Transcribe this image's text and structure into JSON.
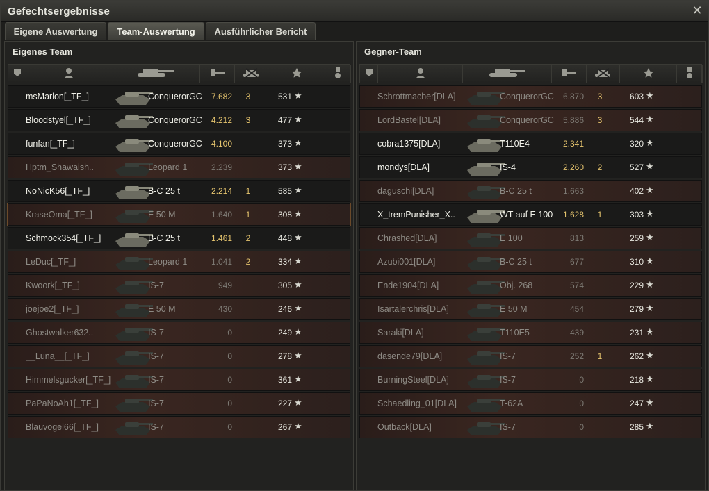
{
  "window": {
    "title": "Gefechtsergebnisse",
    "close_label": "✕"
  },
  "tabs": [
    {
      "label": "Eigene Auswertung"
    },
    {
      "label": "Team-Auswertung"
    },
    {
      "label": "Ausführlicher Bericht"
    }
  ],
  "own_team": {
    "title": "Eigenes Team",
    "rows": [
      {
        "name": "msMarlon[_TF_]",
        "tank": "ConquerorGC",
        "damage": "7.682",
        "kills": "3",
        "xp": "531",
        "alive": true
      },
      {
        "name": "Bloodstyel[_TF_]",
        "tank": "ConquerorGC",
        "damage": "4.212",
        "kills": "3",
        "xp": "477",
        "alive": true
      },
      {
        "name": "funfan[_TF_]",
        "tank": "ConquerorGC",
        "damage": "4.100",
        "kills": "",
        "xp": "373",
        "alive": true
      },
      {
        "name": "Hptm_Shawaish..",
        "tank": "Leopard 1",
        "damage": "2.239",
        "kills": "",
        "xp": "373",
        "alive": false
      },
      {
        "name": "NoNicK56[_TF_]",
        "tank": "B-C 25 t",
        "damage": "2.214",
        "kills": "1",
        "xp": "585",
        "alive": true
      },
      {
        "name": "KraseOma[_TF_]",
        "tank": "E 50 M",
        "damage": "1.640",
        "kills": "1",
        "xp": "308",
        "alive": false,
        "highlight": true
      },
      {
        "name": "Schmock354[_TF_]",
        "tank": "B-C 25 t",
        "damage": "1.461",
        "kills": "2",
        "xp": "448",
        "alive": true
      },
      {
        "name": "LeDuc[_TF_]",
        "tank": "Leopard 1",
        "damage": "1.041",
        "kills": "2",
        "xp": "334",
        "alive": false
      },
      {
        "name": "Kwoork[_TF_]",
        "tank": "IS-7",
        "damage": "949",
        "kills": "",
        "xp": "305",
        "alive": false
      },
      {
        "name": "joejoe2[_TF_]",
        "tank": "E 50 M",
        "damage": "430",
        "kills": "",
        "xp": "246",
        "alive": false
      },
      {
        "name": "Ghostwalker632..",
        "tank": "IS-7",
        "damage": "0",
        "kills": "",
        "xp": "249",
        "alive": false
      },
      {
        "name": "__Luna__[_TF_]",
        "tank": "IS-7",
        "damage": "0",
        "kills": "",
        "xp": "278",
        "alive": false
      },
      {
        "name": "Himmelsgucker[_TF_]",
        "tank": "IS-7",
        "damage": "0",
        "kills": "",
        "xp": "361",
        "alive": false
      },
      {
        "name": "PaPaNoAh1[_TF_]",
        "tank": "IS-7",
        "damage": "0",
        "kills": "",
        "xp": "227",
        "alive": false
      },
      {
        "name": "Blauvogel66[_TF_]",
        "tank": "IS-7",
        "damage": "0",
        "kills": "",
        "xp": "267",
        "alive": false
      }
    ]
  },
  "enemy_team": {
    "title": "Gegner-Team",
    "rows": [
      {
        "name": "Schrottmacher[DLA]",
        "tank": "ConquerorGC",
        "damage": "6.870",
        "kills": "3",
        "xp": "603",
        "alive": false
      },
      {
        "name": "LordBastel[DLA]",
        "tank": "ConquerorGC",
        "damage": "5.886",
        "kills": "3",
        "xp": "544",
        "alive": false
      },
      {
        "name": "cobra1375[DLA]",
        "tank": "T110E4",
        "damage": "2.341",
        "kills": "",
        "xp": "320",
        "alive": true
      },
      {
        "name": "mondys[DLA]",
        "tank": "IS-4",
        "damage": "2.260",
        "kills": "2",
        "xp": "527",
        "alive": true
      },
      {
        "name": "daguschi[DLA]",
        "tank": "B-C 25 t",
        "damage": "1.663",
        "kills": "",
        "xp": "402",
        "alive": false
      },
      {
        "name": "X_tremPunisher_X..",
        "tank": "WT auf E 100",
        "damage": "1.628",
        "kills": "1",
        "xp": "303",
        "alive": true
      },
      {
        "name": "Chrashed[DLA]",
        "tank": "E 100",
        "damage": "813",
        "kills": "",
        "xp": "259",
        "alive": false
      },
      {
        "name": "Azubi001[DLA]",
        "tank": "B-C 25 t",
        "damage": "677",
        "kills": "",
        "xp": "310",
        "alive": false
      },
      {
        "name": "Ende1904[DLA]",
        "tank": "Obj. 268",
        "damage": "574",
        "kills": "",
        "xp": "229",
        "alive": false
      },
      {
        "name": "Isartalerchris[DLA]",
        "tank": "E 50 M",
        "damage": "454",
        "kills": "",
        "xp": "279",
        "alive": false
      },
      {
        "name": "Saraki[DLA]",
        "tank": "T110E5",
        "damage": "439",
        "kills": "",
        "xp": "231",
        "alive": false
      },
      {
        "name": "dasende79[DLA]",
        "tank": "IS-7",
        "damage": "252",
        "kills": "1",
        "xp": "262",
        "alive": false
      },
      {
        "name": "BurningSteel[DLA]",
        "tank": "IS-7",
        "damage": "0",
        "kills": "",
        "xp": "218",
        "alive": false
      },
      {
        "name": "Schaedling_01[DLA]",
        "tank": "T-62A",
        "damage": "0",
        "kills": "",
        "xp": "247",
        "alive": false
      },
      {
        "name": "Outback[DLA]",
        "tank": "IS-7",
        "damage": "0",
        "kills": "",
        "xp": "285",
        "alive": false
      }
    ]
  },
  "icons": {
    "star": "★",
    "columns": [
      "platoon-icon",
      "player-icon",
      "tank-icon",
      "damage-icon",
      "kills-icon",
      "xp-icon",
      "medal-icon"
    ]
  },
  "colors": {
    "gold": "#e5c46e",
    "dead_row": "#3a2620"
  }
}
